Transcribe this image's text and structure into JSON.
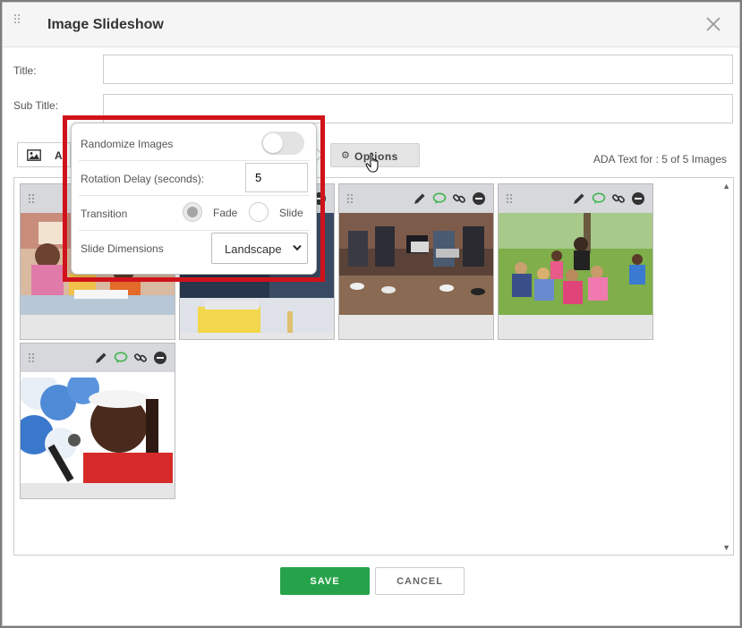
{
  "modal": {
    "title": "Image Slideshow",
    "close_icon": "close-icon"
  },
  "form": {
    "title_label": "Title:",
    "title_value": "",
    "subtitle_label": "Sub Title:",
    "subtitle_value": ""
  },
  "toolbar": {
    "add_label": "A",
    "add_icon": "image-icon",
    "options_label": "Options",
    "options_icon": "gear-icon",
    "ada_text": "ADA Text for : 5 of 5 Images"
  },
  "tiles": [
    {
      "id": 1,
      "icons": [
        "pencil-icon",
        "comment-icon",
        "link-icon",
        "remove-icon"
      ],
      "alt_description_visible": false
    },
    {
      "id": 2,
      "icons": [
        "pencil-icon",
        "comment-icon",
        "link-icon",
        "remove-icon"
      ],
      "alt_description_visible": false
    },
    {
      "id": 3,
      "icons": [
        "pencil-icon",
        "comment-icon",
        "link-icon",
        "remove-icon"
      ],
      "alt_description_visible": false
    },
    {
      "id": 4,
      "icons": [
        "pencil-icon",
        "comment-icon",
        "link-icon",
        "remove-icon"
      ],
      "alt_description_visible": false
    },
    {
      "id": 5,
      "icons": [
        "pencil-icon",
        "comment-icon",
        "link-icon",
        "remove-icon"
      ],
      "alt_description_visible": false
    }
  ],
  "options_popover": {
    "randomize_label": "Randomize Images",
    "randomize_on": false,
    "delay_label": "Rotation Delay (seconds):",
    "delay_value": "5",
    "transition_label": "Transition",
    "transition_options": [
      "Fade",
      "Slide"
    ],
    "transition_selected": "Fade",
    "dimensions_label": "Slide Dimensions",
    "dimensions_value": "Landscape"
  },
  "footer": {
    "save_label": "SAVE",
    "cancel_label": "CANCEL"
  },
  "colors": {
    "save_green": "#26a34a",
    "highlight_red": "#d0121b",
    "comment_green": "#3cb34a",
    "tile_bar": "#d6d8dc"
  }
}
